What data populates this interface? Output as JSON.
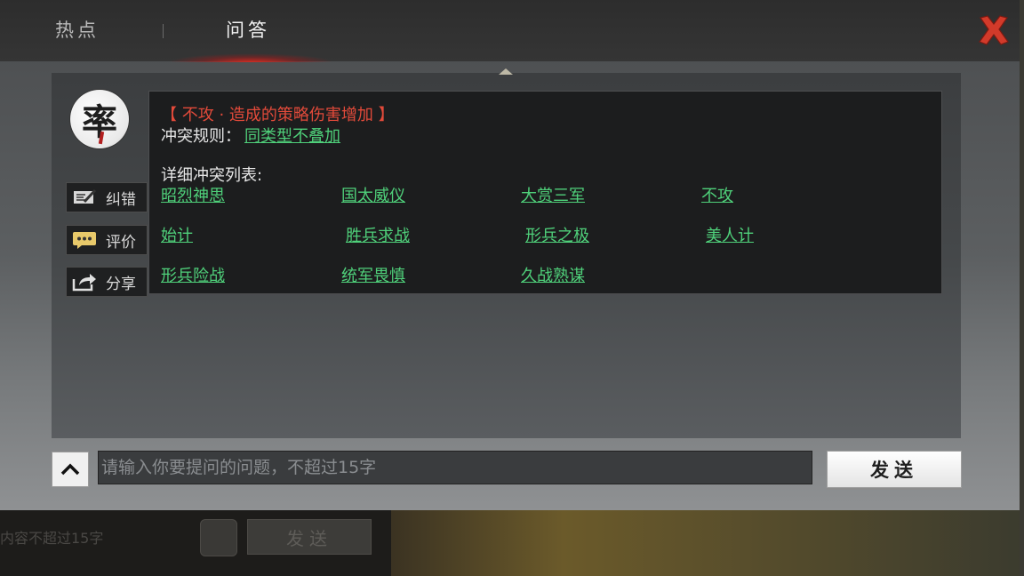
{
  "background": {
    "ghost_text": "内容不超过15字",
    "ghost_send_label": "发送"
  },
  "tabs": [
    {
      "label": "热点",
      "active": false
    },
    {
      "label": "问答",
      "active": true
    }
  ],
  "close_icon": "close-icon",
  "avatar": {
    "char": "率"
  },
  "side_buttons": [
    {
      "label": "纠错",
      "icon": "edit-icon"
    },
    {
      "label": "评价",
      "icon": "comment-icon"
    },
    {
      "label": "分享",
      "icon": "share-icon"
    }
  ],
  "answer": {
    "title": "【 不攻 · 造成的策略伤害增加 】",
    "rule_label": "冲突规则：",
    "rule_link": "同类型不叠加",
    "list_label": "详细冲突列表:",
    "links": [
      "昭烈神思",
      "国太威仪",
      "大赏三军",
      "不攻",
      "始计",
      "胜兵求战",
      "形兵之极",
      "美人计",
      "形兵险战",
      "统军畏慎",
      "久战熟谋"
    ]
  },
  "input": {
    "placeholder": "请输入你要提问的问题，不超过15字",
    "value": ""
  },
  "send_label": "发送",
  "colors": {
    "title_red": "#e24a3a",
    "link_green": "#4fd07a",
    "close_red": "#d23a2a"
  }
}
